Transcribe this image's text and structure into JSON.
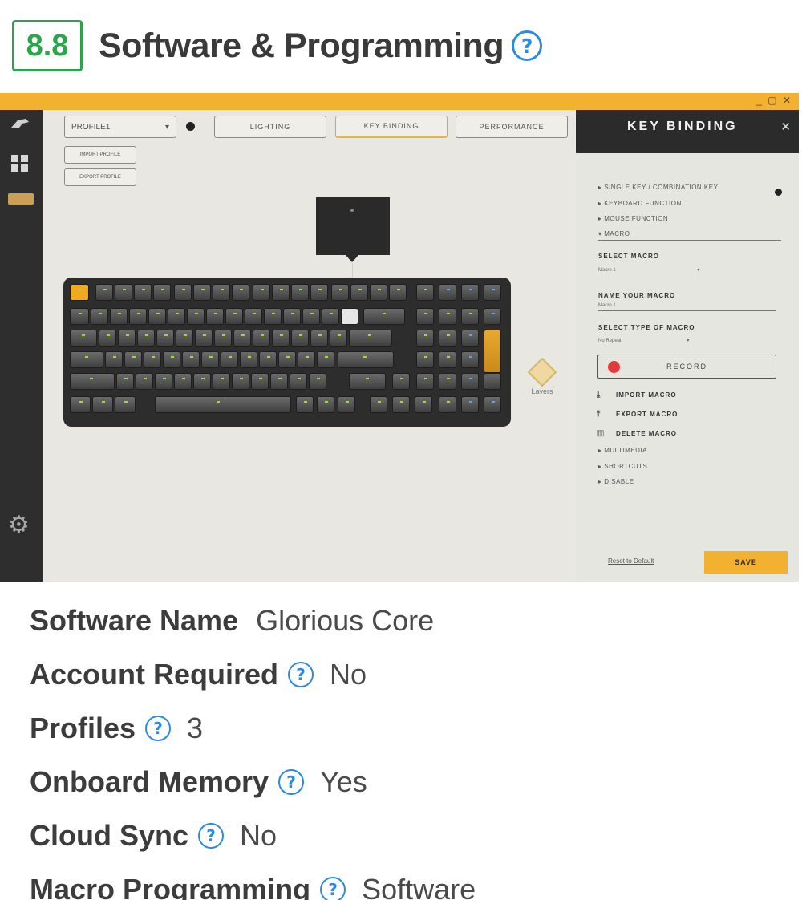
{
  "header": {
    "score": "8.8",
    "title": "Software & Programming",
    "help": "?"
  },
  "app": {
    "window_controls": "_ ▢ ✕",
    "profile_select": "PROFILE1",
    "tabs": [
      "LIGHTING",
      "KEY BINDING",
      "PERFORMANCE"
    ],
    "import_profile": "IMPORT PROFILE",
    "export_profile": "EXPORT PROFILE",
    "layers_label": "Layers",
    "panel": {
      "title": "KEY BINDING",
      "close": "✕",
      "options": [
        "▸ SINGLE KEY / COMBINATION KEY",
        "▸ KEYBOARD FUNCTION",
        "▸ MOUSE FUNCTION",
        "▾ MACRO"
      ],
      "select_macro_label": "SELECT MACRO",
      "select_macro_value": "Macro 1",
      "name_macro_label": "NAME YOUR MACRO",
      "name_macro_value": "Macro 1",
      "type_macro_label": "SELECT TYPE OF MACRO",
      "type_macro_value": "No Repeat",
      "record": "RECORD",
      "import_macro": "IMPORT MACRO",
      "export_macro": "EXPORT MACRO",
      "delete_macro": "DELETE MACRO",
      "more_options": [
        "▸ MULTIMEDIA",
        "▸ SHORTCUTS",
        "▸ DISABLE"
      ],
      "reset": "Reset to Default",
      "save": "SAVE"
    }
  },
  "specs": [
    {
      "label": "Software Name",
      "value": "Glorious Core",
      "help": false
    },
    {
      "label": "Account Required",
      "value": "No",
      "help": true
    },
    {
      "label": "Profiles",
      "value": "3",
      "help": true
    },
    {
      "label": "Onboard Memory",
      "value": "Yes",
      "help": true
    },
    {
      "label": "Cloud Sync",
      "value": "No",
      "help": true
    },
    {
      "label": "Macro Programming",
      "value": "Software",
      "help": true
    }
  ],
  "colors": {
    "score_green": "#2ca44a",
    "help_blue": "#2b8ae2",
    "accent_yellow": "#f2b131",
    "record_red": "#e33b3b"
  }
}
